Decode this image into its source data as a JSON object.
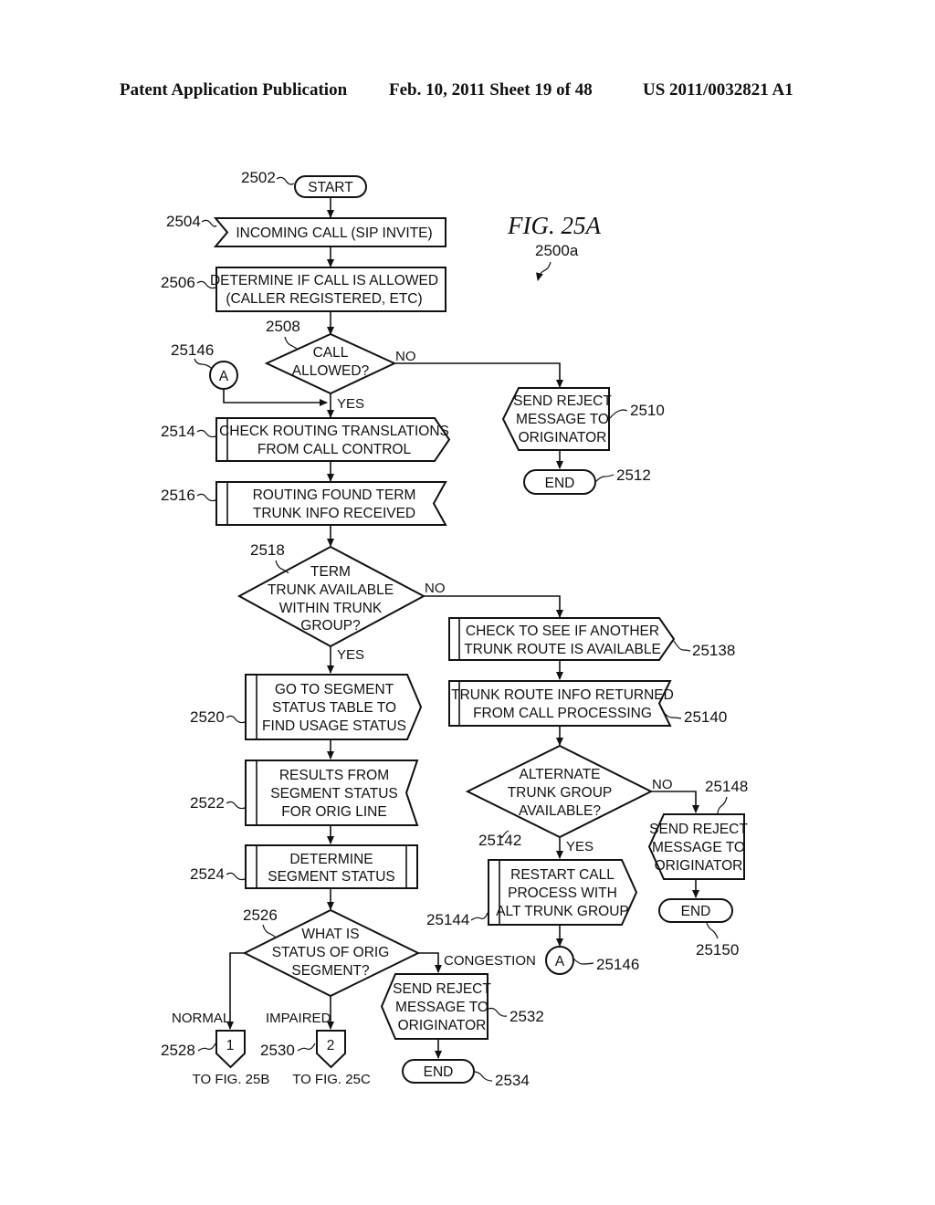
{
  "header": {
    "publication": "Patent Application Publication",
    "date_sheet": "Feb. 10, 2011   Sheet 19 of 48",
    "number": "US 2011/0032821 A1"
  },
  "figure": {
    "title": "FIG. 25A",
    "ref": "2500a"
  },
  "nodes": {
    "start": {
      "ref": "2502",
      "lines": [
        "START"
      ]
    },
    "incoming": {
      "ref": "2504",
      "lines": [
        "INCOMING CALL (SIP INVITE)"
      ]
    },
    "determine_allowed": {
      "ref": "2506",
      "lines": [
        "DETERMINE IF CALL IS ALLOWED",
        "(CALLER REGISTERED, ETC)"
      ]
    },
    "call_allowed": {
      "ref": "2508",
      "lines": [
        "CALL",
        "ALLOWED?"
      ]
    },
    "connector_a_in": {
      "ref": "25146",
      "lines": [
        "A"
      ]
    },
    "reject1": {
      "ref": "2510",
      "lines": [
        "SEND REJECT",
        "MESSAGE TO",
        "ORIGINATOR"
      ]
    },
    "end1": {
      "ref": "2512",
      "lines": [
        "END"
      ]
    },
    "check_routing": {
      "ref": "2514",
      "lines": [
        "CHECK ROUTING TRANSLATIONS",
        "FROM CALL CONTROL"
      ]
    },
    "routing_found": {
      "ref": "2516",
      "lines": [
        "ROUTING FOUND TERM",
        "TRUNK INFO RECEIVED"
      ]
    },
    "term_trunk": {
      "ref": "2518",
      "lines": [
        "TERM",
        "TRUNK AVAILABLE",
        "WITHIN TRUNK",
        "GROUP?"
      ]
    },
    "check_another": {
      "ref": "25138",
      "lines": [
        "CHECK TO SEE IF ANOTHER",
        "TRUNK ROUTE IS AVAILABLE"
      ]
    },
    "trunk_route_info": {
      "ref": "25140",
      "lines": [
        "TRUNK ROUTE INFO RETURNED",
        "FROM CALL PROCESSING"
      ]
    },
    "go_to_segment": {
      "ref": "2520",
      "lines": [
        "GO TO SEGMENT",
        "STATUS TABLE TO",
        "FIND USAGE STATUS"
      ]
    },
    "results_segment": {
      "ref": "2522",
      "lines": [
        "RESULTS FROM",
        "SEGMENT STATUS",
        "FOR ORIG LINE"
      ]
    },
    "determine_segment": {
      "ref": "2524",
      "lines": [
        "DETERMINE",
        "SEGMENT STATUS"
      ]
    },
    "alt_trunk": {
      "ref": "25142",
      "lines": [
        "ALTERNATE",
        "TRUNK GROUP",
        "AVAILABLE?"
      ]
    },
    "reject2": {
      "ref": "25148",
      "lines": [
        "SEND REJECT",
        "MESSAGE TO",
        "ORIGINATOR"
      ]
    },
    "end2": {
      "ref": "25150",
      "lines": [
        "END"
      ]
    },
    "restart_call": {
      "ref": "25144",
      "lines": [
        "RESTART CALL",
        "PROCESS WITH",
        "ALT TRUNK GROUP"
      ]
    },
    "connector_a_out": {
      "ref": "25146",
      "lines": [
        "A"
      ]
    },
    "status_orig": {
      "ref": "2526",
      "lines": [
        "WHAT IS",
        "STATUS OF ORIG",
        "SEGMENT?"
      ]
    },
    "offpage1": {
      "ref": "2528",
      "lines": [
        "1"
      ],
      "caption": "TO FIG. 25B"
    },
    "offpage2": {
      "ref": "2530",
      "lines": [
        "2"
      ],
      "caption": "TO FIG. 25C"
    },
    "reject3": {
      "ref": "2532",
      "lines": [
        "SEND REJECT",
        "MESSAGE TO",
        "ORIGINATOR"
      ]
    },
    "end3": {
      "ref": "2534",
      "lines": [
        "END"
      ]
    }
  },
  "edge_labels": {
    "no1": "NO",
    "yes1": "YES",
    "no2": "NO",
    "yes2": "YES",
    "no3": "NO",
    "yes3": "YES",
    "normal": "NORMAL",
    "impaired": "IMPAIRED",
    "congestion": "CONGESTION"
  }
}
